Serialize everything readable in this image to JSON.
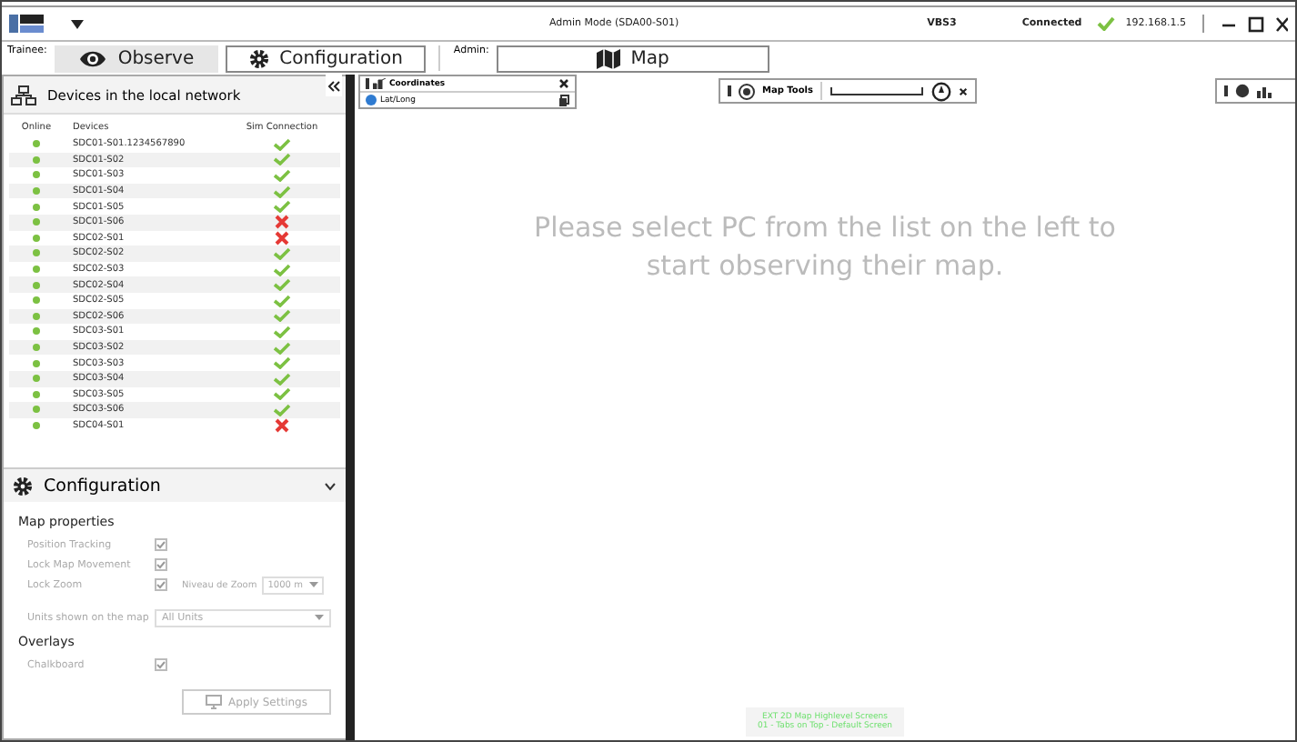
{
  "window": {
    "title": "Admin Mode (SDA00-S01)",
    "app": "VBS3",
    "status": "Connected",
    "connected": true,
    "address": "192.168.1.5"
  },
  "toolbar": {
    "trainee_label": "Trainee:",
    "admin_label": "Admin:",
    "tabs": [
      {
        "label": "Observe",
        "selected": true
      },
      {
        "label": "Configuration",
        "selected": false
      },
      {
        "label": "Map",
        "selected": false
      }
    ]
  },
  "devices_panel": {
    "title": "Devices in the local network",
    "columns": [
      "Online",
      "Devices",
      "Sim Connection"
    ],
    "rows": [
      {
        "device": "SDC01-S01.1234567890",
        "online": true,
        "sim_connection": true
      },
      {
        "device": "SDC01-S02",
        "online": true,
        "sim_connection": true
      },
      {
        "device": "SDC01-S03",
        "online": true,
        "sim_connection": true
      },
      {
        "device": "SDC01-S04",
        "online": true,
        "sim_connection": true
      },
      {
        "device": "SDC01-S05",
        "online": true,
        "sim_connection": true
      },
      {
        "device": "SDC01-S06",
        "online": true,
        "sim_connection": false
      },
      {
        "device": "SDC02-S01",
        "online": true,
        "sim_connection": false
      },
      {
        "device": "SDC02-S02",
        "online": true,
        "sim_connection": true
      },
      {
        "device": "SDC02-S03",
        "online": true,
        "sim_connection": true
      },
      {
        "device": "SDC02-S04",
        "online": true,
        "sim_connection": true
      },
      {
        "device": "SDC02-S05",
        "online": true,
        "sim_connection": true
      },
      {
        "device": "SDC02-S06",
        "online": true,
        "sim_connection": true
      },
      {
        "device": "SDC03-S01",
        "online": true,
        "sim_connection": true
      },
      {
        "device": "SDC03-S02",
        "online": true,
        "sim_connection": true
      },
      {
        "device": "SDC03-S03",
        "online": true,
        "sim_connection": true
      },
      {
        "device": "SDC03-S04",
        "online": true,
        "sim_connection": true
      },
      {
        "device": "SDC03-S05",
        "online": true,
        "sim_connection": true
      },
      {
        "device": "SDC03-S06",
        "online": true,
        "sim_connection": true
      },
      {
        "device": "SDC04-S01",
        "online": true,
        "sim_connection": false
      }
    ]
  },
  "configuration": {
    "title": "Configuration",
    "expanded": true,
    "sections": [
      {
        "heading": "Map properties",
        "items": [
          {
            "kind": "checkbox",
            "label": "Position Tracking",
            "checked": true,
            "disabled": true
          },
          {
            "kind": "checkbox",
            "label": "Lock Map Movement",
            "checked": true,
            "disabled": true
          },
          {
            "kind": "checkbox",
            "label": "Lock Zoom",
            "checked": true,
            "disabled": true,
            "extra_label": "Niveau de Zoom",
            "extra_value": "1000 m"
          },
          {
            "kind": "select",
            "label": "Units shown on the map",
            "value": "All Units",
            "disabled": true
          }
        ]
      },
      {
        "heading": "Overlays",
        "items": [
          {
            "kind": "checkbox",
            "label": "Chalkboard",
            "checked": true,
            "disabled": true
          }
        ]
      }
    ],
    "apply_button": {
      "label": "Apply Settings",
      "disabled": true
    }
  },
  "map": {
    "message": "Please select PC from the list on the left to start observing their map.",
    "coordinates_panel": {
      "title": "Coordinates",
      "mode": "Lat/Long"
    },
    "map_tools": {
      "title": "Map Tools"
    },
    "screen_note": [
      "EXT 2D Map Highlevel Screens",
      "01 - Tabs on Top - Default Screen"
    ]
  }
}
